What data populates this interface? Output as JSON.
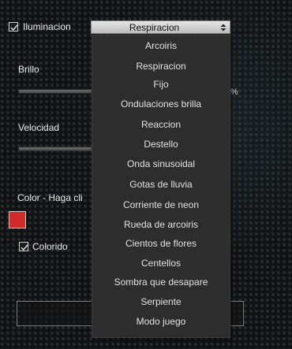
{
  "lighting": {
    "checkbox_label": "Iluminacion",
    "checked": true
  },
  "effect_select": {
    "selected": "Respiracion",
    "options": [
      "Arcoiris",
      "Respiracion",
      "Fijo",
      "Ondulaciones brilla",
      "Reaccion",
      "Destello",
      "Onda sinusoidal",
      "Gotas de lluvia",
      "Corriente de neon",
      "Rueda de arcoiris",
      "Cientos de flores",
      "Centellos",
      "Sombra que desapare",
      "Serpiente",
      "Modo juego"
    ]
  },
  "brightness": {
    "label": "Brillo",
    "suffix": "%"
  },
  "speed": {
    "label": "Velocidad"
  },
  "color": {
    "label": "Color - Haga cli",
    "swatch_color": "#d02a2a"
  },
  "colorful": {
    "checkbox_label": "Colorido",
    "checked": true
  }
}
